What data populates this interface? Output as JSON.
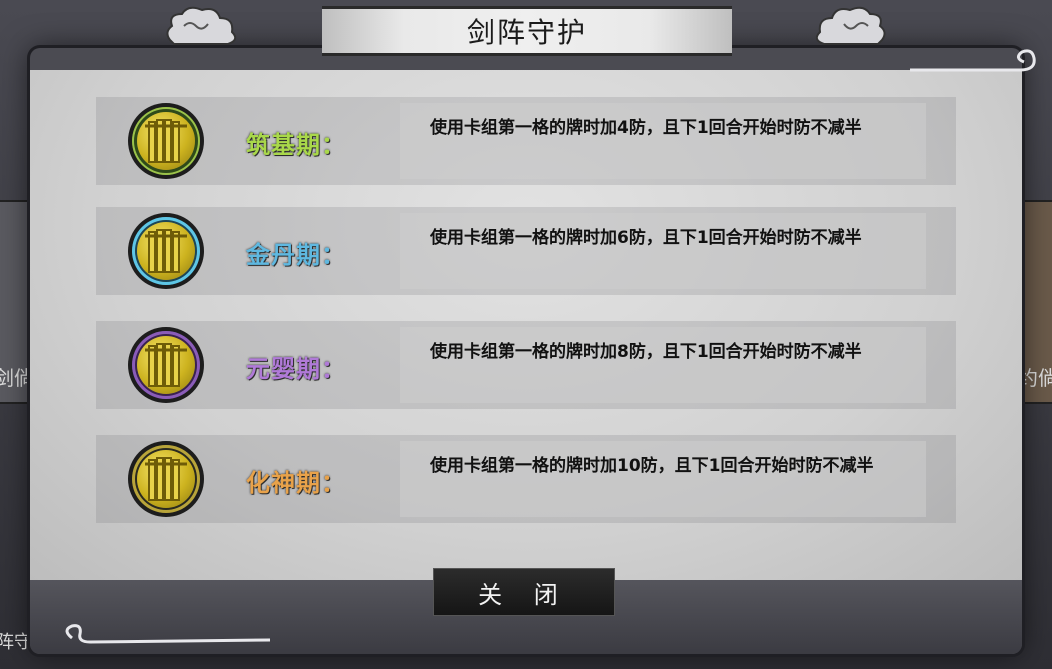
{
  "dialog": {
    "title": "剑阵守护",
    "close_label": "关 闭"
  },
  "tiers": [
    {
      "label": "筑基期：",
      "description": "使用卡组第一格的牌时加4防，且下1回合开始时防不减半",
      "color": "#a9d84a",
      "ring_color": "#2f4a1a"
    },
    {
      "label": "金丹期：",
      "description": "使用卡组第一格的牌时加6防，且下1回合开始时防不减半",
      "color": "#5fb8e0",
      "ring_color": "#3fa8c8"
    },
    {
      "label": "元婴期：",
      "description": "使用卡组第一格的牌时加8防，且下1回合开始时防不减半",
      "color": "#b07ad8",
      "ring_color": "#6a3d8e"
    },
    {
      "label": "化神期：",
      "description": "使用卡组第一格的牌时加10防，且下1回合开始时防不减半",
      "color": "#e8a24a",
      "ring_color": "#3a3a2a"
    }
  ],
  "background": {
    "left_text": "剑倘",
    "right_text": "约倘",
    "bottom_text": "阵守"
  }
}
